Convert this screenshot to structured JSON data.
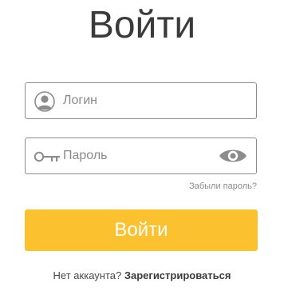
{
  "title": "Войти",
  "login": {
    "placeholder": "Логин",
    "icon": "user-icon"
  },
  "password": {
    "placeholder": "Пароль",
    "icon": "key-icon",
    "toggle_icon": "eye-icon"
  },
  "forgot_link": "Забыли пароль?",
  "submit_label": "Войти",
  "signup": {
    "prompt": "Нет аккаунта?",
    "link": "Зарегистрироваться"
  },
  "colors": {
    "accent": "#fbc12e",
    "text": "#3a3a3a",
    "border": "#8c8c8c",
    "muted": "#8a8a8a"
  }
}
